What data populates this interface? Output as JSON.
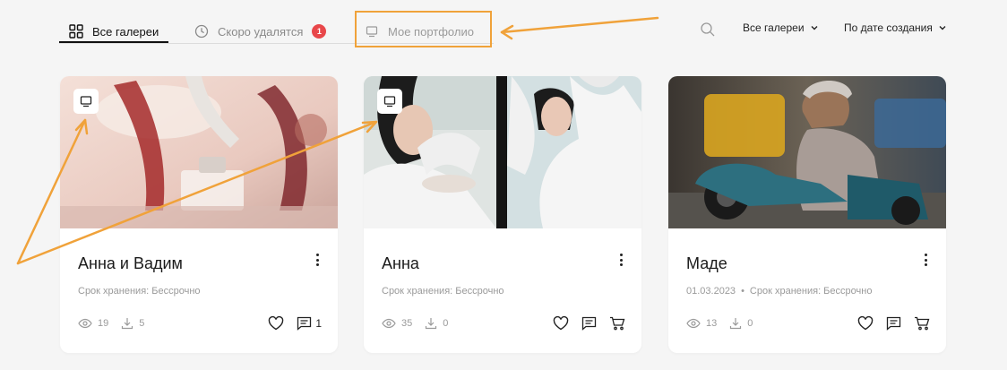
{
  "tabs": {
    "all": {
      "label": "Все галереи"
    },
    "soon": {
      "label": "Скоро удалятся",
      "badge": "1"
    },
    "portfolio": {
      "label": "Мое портфолио"
    }
  },
  "filters": {
    "galleries": "Все галереи",
    "sort": "По дате создания"
  },
  "cards": [
    {
      "title": "Анна и Вадим",
      "date": "",
      "storage": "Срок хранения: Бессрочно",
      "views": "19",
      "downloads": "5",
      "comments": "1",
      "portfolio": true
    },
    {
      "title": "Анна",
      "date": "",
      "storage": "Срок хранения: Бессрочно",
      "views": "35",
      "downloads": "0",
      "comments": "",
      "portfolio": true
    },
    {
      "title": "Маде",
      "date": "01.03.2023",
      "date_separator": "•",
      "storage": "Срок хранения: Бессрочно",
      "views": "13",
      "downloads": "0",
      "comments": "",
      "portfolio": false
    }
  ],
  "colors": {
    "accent_annotation": "#f0a23a",
    "badge": "#e8474a"
  }
}
